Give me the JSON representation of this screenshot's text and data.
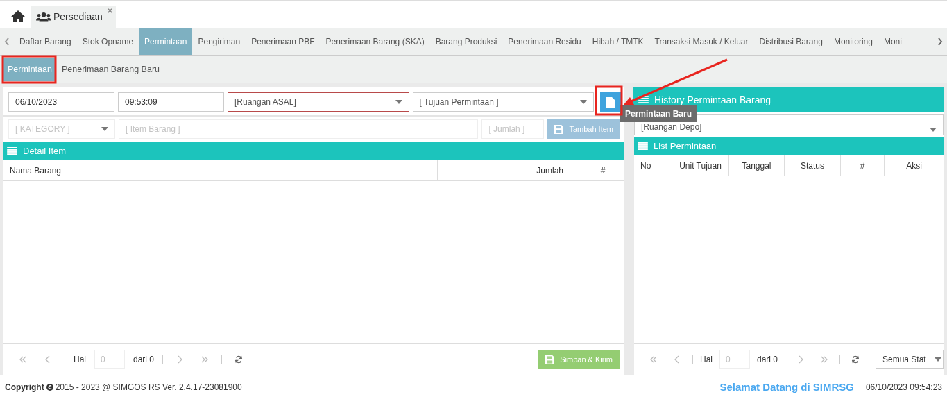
{
  "module_tabs": [
    {
      "label": "Persediaan",
      "selected": true
    }
  ],
  "menu_tabs": [
    {
      "label": "Daftar Barang",
      "selected": false
    },
    {
      "label": "Stok Opname",
      "selected": false
    },
    {
      "label": "Permintaan",
      "selected": true
    },
    {
      "label": "Pengiriman",
      "selected": false
    },
    {
      "label": "Penerimaan PBF",
      "selected": false
    },
    {
      "label": "Penerimaan Barang (SKA)",
      "selected": false
    },
    {
      "label": "Barang Produksi",
      "selected": false
    },
    {
      "label": "Penerimaan Residu",
      "selected": false
    },
    {
      "label": "Hibah / TMTK",
      "selected": false
    },
    {
      "label": "Transaksi Masuk / Keluar",
      "selected": false
    },
    {
      "label": "Distribusi Barang",
      "selected": false
    },
    {
      "label": "Monitoring",
      "selected": false
    },
    {
      "label": "Moni",
      "selected": false
    }
  ],
  "sub_tabs": [
    {
      "label": "Permintaan",
      "selected": true
    },
    {
      "label": "Penerimaan Barang Baru",
      "selected": false
    }
  ],
  "request_form": {
    "date": "06/10/2023",
    "time": "09:53:09",
    "origin_placeholder": "[Ruangan ASAL]",
    "destination_placeholder": "[ Tujuan Permintaan ]",
    "new_button_tooltip": "Permintaan Baru",
    "category_placeholder": "[ KATEGORY ]",
    "item_placeholder": "[ Item Barang ]",
    "quantity_placeholder": "[ Jumlah ]",
    "add_button": {
      "label": "Tambah Item",
      "disabled": true
    }
  },
  "detail_panel": {
    "title": "Detail Item",
    "columns": [
      "Nama Barang",
      "Jumlah",
      "#"
    ],
    "pager": {
      "page_label": "Hal",
      "page_placeholder": "0",
      "of_label": "dari 0"
    },
    "save_button": {
      "label": "Simpan & Kirim",
      "disabled": true
    }
  },
  "history_panel": {
    "title": "History Permintaan Barang",
    "depot_placeholder": "[Ruangan Depo]",
    "list_title": "List Permintaan",
    "columns": [
      "No",
      "Unit Tujuan",
      "Tanggal",
      "Status",
      "#",
      "Aksi"
    ],
    "pager": {
      "page_label": "Hal",
      "page_placeholder": "0",
      "of_label": "dari 0"
    },
    "status_filter": "Semua Stat"
  },
  "footer": {
    "copyright_label": "Copyright",
    "copyright_text": "2015 - 2023 @ SIMGOS RS Ver. 2.4.17-23081900",
    "welcome": "Selamat Datang di SIMRSG",
    "datetime": "06/10/2023 09:54:23"
  }
}
